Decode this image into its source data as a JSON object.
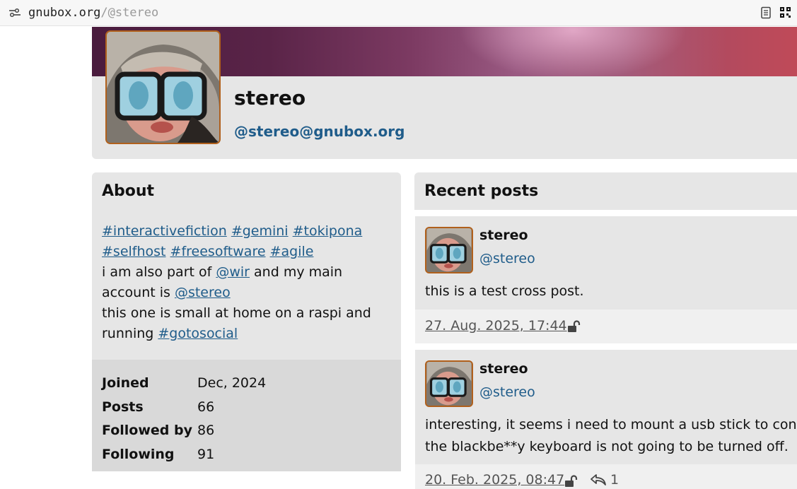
{
  "browser": {
    "url_host": "gnubox.org",
    "url_path": "/@stereo"
  },
  "profile": {
    "display_name": "stereo",
    "handle": "@stereo@gnubox.org"
  },
  "about": {
    "heading": "About",
    "tags": [
      "#interactivefiction",
      "#gemini",
      "#tokipona",
      "#selfhost",
      "#freesoftware",
      "#agile"
    ],
    "bio_text_1": "i am also part of ",
    "bio_link_wir": "@wir",
    "bio_text_2": " and my main account is ",
    "bio_link_stereo": "@stereo",
    "bio_text_3": "this one is small at home on a raspi and running ",
    "bio_link_gotosocial": "#gotosocial",
    "stats": [
      {
        "label": "Joined",
        "value": "Dec, 2024"
      },
      {
        "label": "Posts",
        "value": "66"
      },
      {
        "label": "Followed by",
        "value": "86"
      },
      {
        "label": "Following",
        "value": "91"
      }
    ]
  },
  "recent": {
    "heading": "Recent posts",
    "posts": [
      {
        "name": "stereo",
        "handle": "@stereo",
        "text_lines": [
          "this is a test cross post."
        ],
        "date": "27. Aug. 2025, 17:44"
      },
      {
        "name": "stereo",
        "handle": "@stereo",
        "text_lines": [
          "interesting, it seems i need to mount a usb stick to consum",
          "the blackbe**y keyboard is not going to be turned off."
        ],
        "date": "20. Feb. 2025, 08:47",
        "replies": "1"
      }
    ]
  },
  "colors": {
    "link": "#1f5c8a",
    "avatar_border": "#b0601c",
    "panel": "#e6e6e6"
  },
  "icons": [
    "site-info-icon",
    "reader-mode-icon",
    "qr-code-icon",
    "lock-open-icon",
    "reply-icon"
  ]
}
